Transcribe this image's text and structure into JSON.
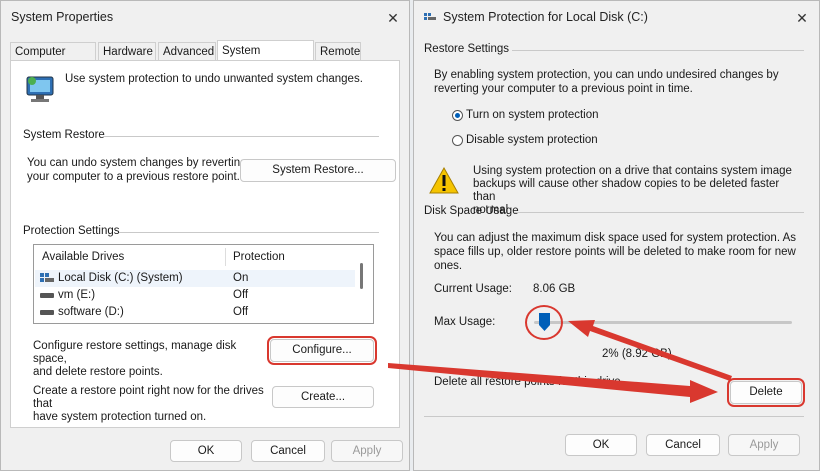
{
  "left_window": {
    "title": "System Properties",
    "tabs": [
      "Computer Name",
      "Hardware",
      "Advanced",
      "System Protection",
      "Remote"
    ],
    "intro_text": "Use system protection to undo unwanted system changes.",
    "system_restore": {
      "group_label": "System Restore",
      "description": "You can undo system changes by reverting\nyour computer to a previous restore point.",
      "button": "System Restore..."
    },
    "protection_settings": {
      "group_label": "Protection Settings",
      "columns": [
        "Available Drives",
        "Protection"
      ],
      "rows": [
        {
          "drive": "Local Disk (C:) (System)",
          "protection": "On"
        },
        {
          "drive": "vm (E:)",
          "protection": "Off"
        },
        {
          "drive": "software (D:)",
          "protection": "Off"
        }
      ],
      "configure_text": "Configure restore settings, manage disk space,\nand delete restore points.",
      "configure_button": "Configure...",
      "create_text": "Create a restore point right now for the drives that\nhave system protection turned on.",
      "create_button": "Create..."
    },
    "footer": {
      "ok": "OK",
      "cancel": "Cancel",
      "apply": "Apply"
    }
  },
  "right_window": {
    "title": "System Protection for Local Disk (C:)",
    "restore_settings": {
      "group_label": "Restore Settings",
      "description": "By enabling system protection, you can undo undesired changes by\nreverting your computer to a previous point in time.",
      "option_on": "Turn on system protection",
      "option_off": "Disable system protection",
      "selected": "on",
      "warning": "Using system protection on a drive that contains system image\nbackups will cause other shadow copies to be deleted faster than\nnormal"
    },
    "disk_space": {
      "group_label": "Disk Space Usage",
      "description": "You can adjust the maximum disk space used for system protection. As\nspace fills up, older restore points will be deleted to make room for new\nones.",
      "current_usage_label": "Current Usage:",
      "current_usage_value": "8.06 GB",
      "max_usage_label": "Max Usage:",
      "max_usage_value": "2% (8.92 GB)",
      "slider_level_percent": 2,
      "delete_text": "Delete all restore points for this drive.",
      "delete_button": "Delete"
    },
    "footer": {
      "ok": "OK",
      "cancel": "Cancel",
      "apply": "Apply"
    }
  },
  "colors": {
    "accent": "#005fb8",
    "annotation_red": "#d9382f",
    "warning_yellow": "#f5c400"
  }
}
